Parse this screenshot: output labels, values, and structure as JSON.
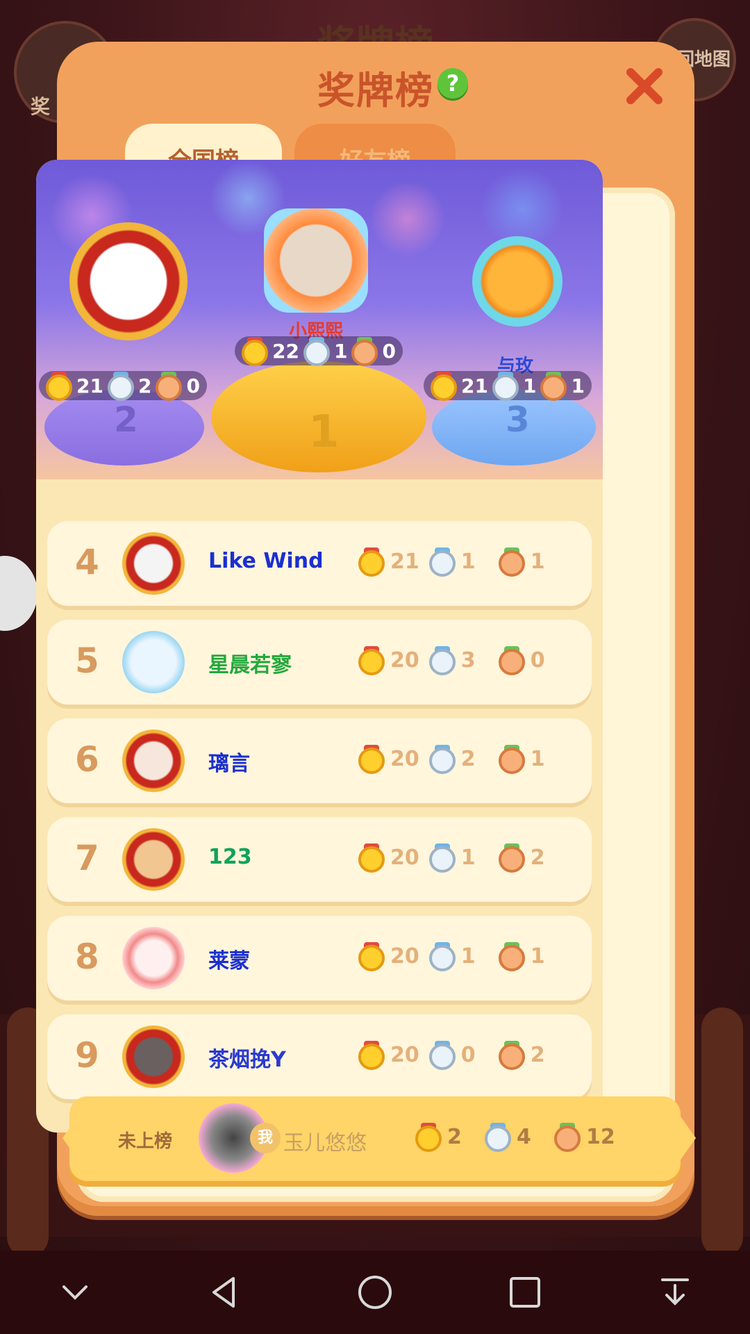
{
  "background": {
    "title": "奖牌榜",
    "left_button_label": "奖",
    "right_button_label": "返回地图"
  },
  "modal": {
    "title": "奖牌榜",
    "help_icon": "question-icon",
    "close_icon": "close-icon"
  },
  "tabs": [
    {
      "label": "全国榜",
      "active": true
    },
    {
      "label": "好友榜",
      "active": false
    }
  ],
  "podium": {
    "first": {
      "rank": "1",
      "name": "小熙熙",
      "name_color": "#e83a2a",
      "gold": "22",
      "silver": "1",
      "bronze": "0"
    },
    "second": {
      "rank": "2",
      "name": "",
      "gold": "21",
      "silver": "2",
      "bronze": "0"
    },
    "third": {
      "rank": "3",
      "name": "与玫",
      "name_color": "#2a4ad8",
      "gold": "21",
      "silver": "1",
      "bronze": "1"
    }
  },
  "rows": [
    {
      "rank": "4",
      "name": "Like  Wind",
      "name_color": "#1b2fd0",
      "gold": "21",
      "silver": "1",
      "bronze": "1"
    },
    {
      "rank": "5",
      "name": "星晨若寥",
      "name_color": "#24a83c",
      "gold": "20",
      "silver": "3",
      "bronze": "0"
    },
    {
      "rank": "6",
      "name": "璃言",
      "name_color": "#1b2fd0",
      "gold": "20",
      "silver": "2",
      "bronze": "1"
    },
    {
      "rank": "7",
      "name": "123",
      "name_color": "#12a25a",
      "gold": "20",
      "silver": "1",
      "bronze": "2"
    },
    {
      "rank": "8",
      "name": "莱蒙",
      "name_color": "#1b2fd0",
      "gold": "20",
      "silver": "1",
      "bronze": "1"
    },
    {
      "rank": "9",
      "name": "茶烟挽Y",
      "name_color": "#2a3ad0",
      "gold": "20",
      "silver": "0",
      "bronze": "2"
    }
  ],
  "me": {
    "status": "未上榜",
    "badge": "我",
    "name": "玉儿悠悠",
    "gold": "2",
    "silver": "4",
    "bronze": "12"
  },
  "navbar": [
    "chevron-down-icon",
    "back-triangle-icon",
    "home-circle-icon",
    "recents-square-icon",
    "download-icon"
  ]
}
